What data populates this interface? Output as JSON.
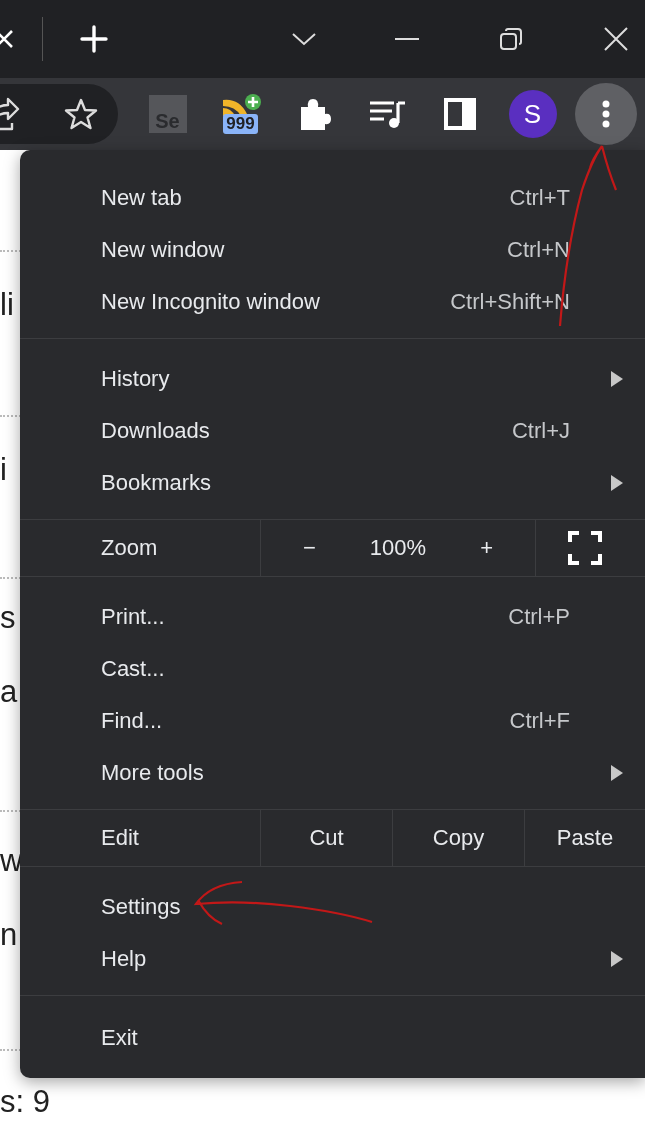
{
  "toolbar": {
    "extension_badge": "999",
    "extension_label": "Se",
    "avatar": "S"
  },
  "page": {
    "blocks": [
      {
        "lines": [
          "li"
        ]
      },
      {
        "lines": [
          "i"
        ]
      },
      {
        "lines": [
          "s",
          "a"
        ]
      },
      {
        "lines": [
          "w",
          "n"
        ]
      },
      {
        "lines": [
          "s: 9"
        ]
      }
    ]
  },
  "menu": {
    "sections": [
      {
        "items": [
          {
            "kind": "command",
            "label": "New tab",
            "shortcut": "Ctrl+T"
          },
          {
            "kind": "command",
            "label": "New window",
            "shortcut": "Ctrl+N"
          },
          {
            "kind": "command",
            "label": "New Incognito window",
            "shortcut": "Ctrl+Shift+N"
          }
        ]
      },
      {
        "items": [
          {
            "kind": "submenu",
            "label": "History"
          },
          {
            "kind": "command",
            "label": "Downloads",
            "shortcut": "Ctrl+J"
          },
          {
            "kind": "submenu",
            "label": "Bookmarks"
          }
        ]
      },
      {
        "items": [
          {
            "kind": "zoom",
            "label": "Zoom",
            "minus": "−",
            "value": "100%",
            "plus": "+"
          }
        ]
      },
      {
        "items": [
          {
            "kind": "command",
            "label": "Print...",
            "shortcut": "Ctrl+P"
          },
          {
            "kind": "command",
            "label": "Cast..."
          },
          {
            "kind": "command",
            "label": "Find...",
            "shortcut": "Ctrl+F"
          },
          {
            "kind": "submenu",
            "label": "More tools"
          }
        ]
      },
      {
        "items": [
          {
            "kind": "edit",
            "label": "Edit",
            "buttons": [
              "Cut",
              "Copy",
              "Paste"
            ]
          }
        ]
      },
      {
        "items": [
          {
            "kind": "command",
            "label": "Settings"
          },
          {
            "kind": "submenu",
            "label": "Help"
          }
        ]
      },
      {
        "items": [
          {
            "kind": "command",
            "label": "Exit"
          }
        ]
      }
    ]
  }
}
